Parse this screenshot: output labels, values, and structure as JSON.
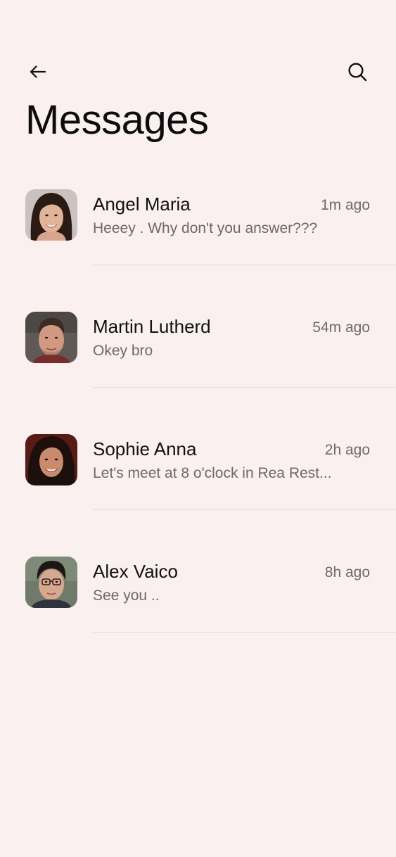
{
  "header": {
    "title": "Messages",
    "back_icon": "arrow-left-icon",
    "search_icon": "search-icon"
  },
  "messages": [
    {
      "name": "Angel Maria",
      "preview": "Heeey . Why don't you answer???",
      "time": "1m ago",
      "avatar": "avatar-angel-maria"
    },
    {
      "name": "Martin Lutherd",
      "preview": "Okey bro",
      "time": "54m ago",
      "avatar": "avatar-martin-lutherd"
    },
    {
      "name": "Sophie Anna",
      "preview": "Let's meet at 8 o'clock in Rea Rest...",
      "time": "2h ago",
      "avatar": "avatar-sophie-anna"
    },
    {
      "name": "Alex Vaico",
      "preview": "See you ..",
      "time": "8h ago",
      "avatar": "avatar-alex-vaico"
    }
  ],
  "colors": {
    "background": "#fbf0f0",
    "text_primary": "#111111",
    "text_secondary": "#6f6868",
    "divider": "#e4dada"
  }
}
